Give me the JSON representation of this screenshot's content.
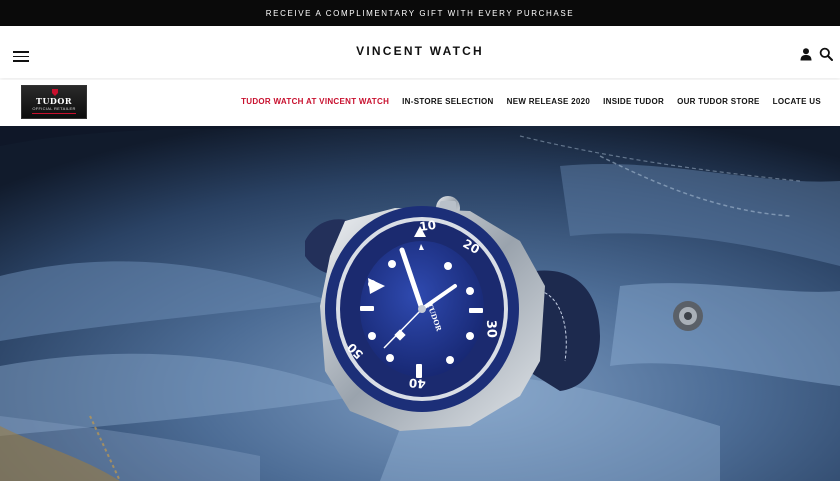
{
  "promo": {
    "text": "RECEIVE A COMPLIMENTARY GIFT WITH EVERY PURCHASE"
  },
  "header": {
    "brand": "VINCENT WATCH",
    "icons": {
      "menu": "hamburger-menu-icon",
      "account": "user-icon",
      "search": "search-icon"
    }
  },
  "subnav": {
    "logo": {
      "brand": "TUDOR",
      "tagline": "OFFICIAL RETAILER"
    },
    "links": [
      {
        "label": "TUDOR WATCH AT VINCENT WATCH",
        "active": true
      },
      {
        "label": "IN-STORE SELECTION"
      },
      {
        "label": "NEW RELEASE 2020"
      },
      {
        "label": "INSIDE TUDOR"
      },
      {
        "label": "OUR TUDOR STORE"
      },
      {
        "label": "LOCATE US"
      }
    ]
  },
  "hero": {
    "bezel_numbers": [
      "10",
      "20",
      "30",
      "40",
      "50"
    ],
    "dial_brand": "TUDOR"
  },
  "colors": {
    "accent": "#c8102e",
    "promo_bg": "#0a0a0a",
    "watch_blue": "#1b2f7a"
  }
}
